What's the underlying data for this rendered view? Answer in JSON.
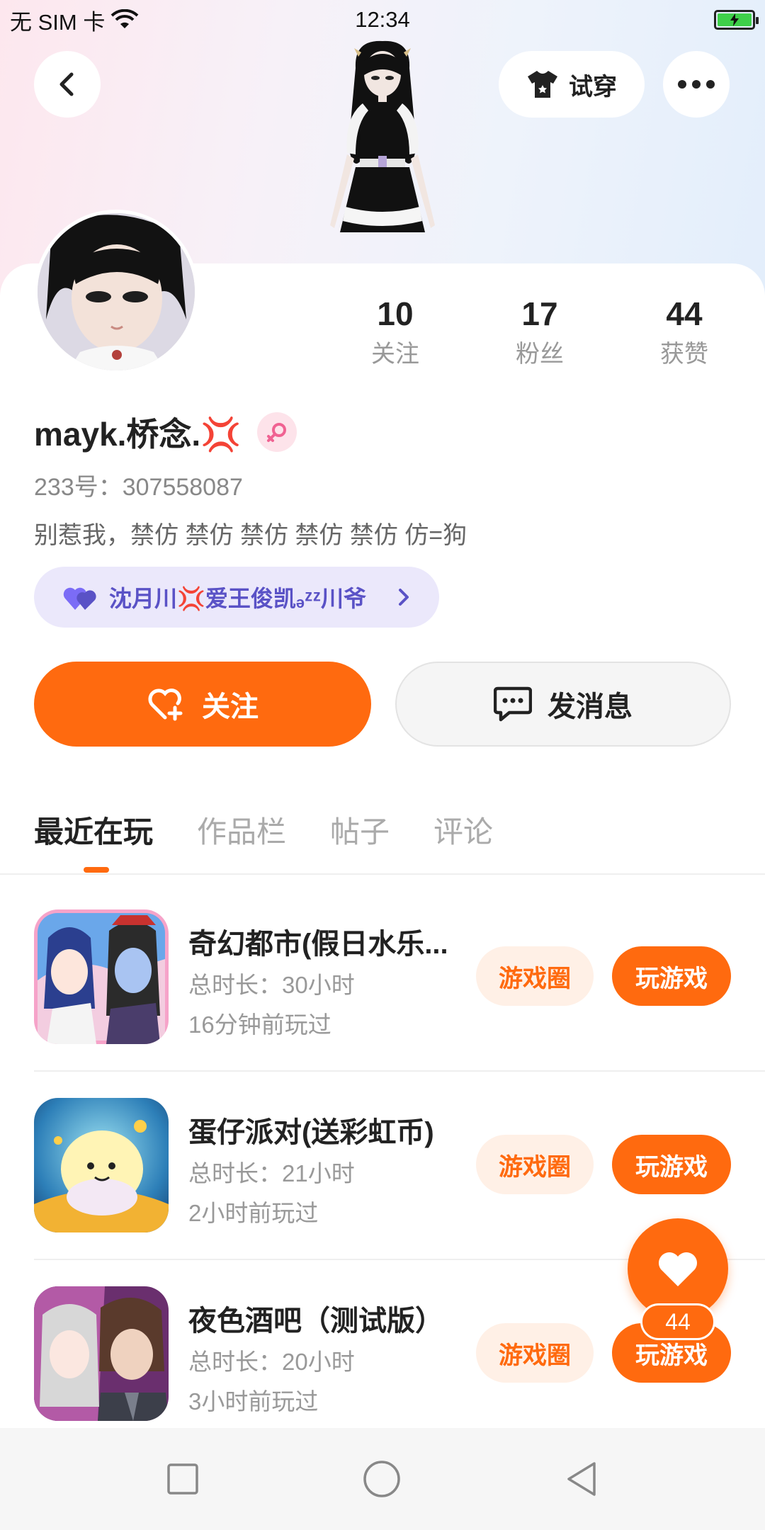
{
  "status_bar": {
    "carrier": "无 SIM 卡",
    "time": "12:34"
  },
  "header": {
    "tryon_label": "试穿"
  },
  "profile": {
    "stats": [
      {
        "value": "10",
        "label": "关注"
      },
      {
        "value": "17",
        "label": "粉丝"
      },
      {
        "value": "44",
        "label": "获赞"
      }
    ],
    "name": "mayk.桥念.💢",
    "uid": "233号：307558087",
    "bio": "别惹我，禁仿 禁仿 禁仿 禁仿 禁仿 仿=狗",
    "cp_text": "沈月川💢爱王俊凯ₔᶻᶻ川爷"
  },
  "actions": {
    "follow_label": "关注",
    "message_label": "发消息"
  },
  "tabs": [
    "最近在玩",
    "作品栏",
    "帖子",
    "评论"
  ],
  "games": [
    {
      "name": "奇幻都市(假日水乐...",
      "duration": "总时长：30小时",
      "last_played": "16分钟前玩过",
      "circle_label": "游戏圈",
      "play_label": "玩游戏"
    },
    {
      "name": "蛋仔派对(送彩虹币)",
      "duration": "总时长：21小时",
      "last_played": "2小时前玩过",
      "circle_label": "游戏圈",
      "play_label": "玩游戏"
    },
    {
      "name": "夜色酒吧（测试版）",
      "duration": "总时长：20小时",
      "last_played": "3小时前玩过",
      "circle_label": "游戏圈",
      "play_label": "玩游戏"
    }
  ],
  "like_fab": {
    "count": "44"
  },
  "colors": {
    "accent": "#ff6a0f",
    "accent_light": "#fff0e6",
    "cp_bg": "#ebe8fb",
    "cp_text": "#5a52c6"
  }
}
